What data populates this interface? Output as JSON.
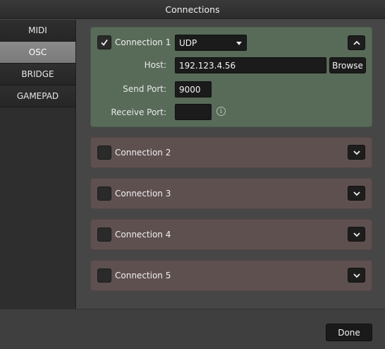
{
  "window": {
    "title": "Connections"
  },
  "sidebar": {
    "items": [
      {
        "label": "MIDI",
        "active": false
      },
      {
        "label": "OSC",
        "active": true
      },
      {
        "label": "BRIDGE",
        "active": false
      },
      {
        "label": "GAMEPAD",
        "active": false
      }
    ]
  },
  "connections": [
    {
      "label": "Connection 1",
      "checked": true,
      "expanded": true,
      "protocol": "UDP",
      "host_label": "Host:",
      "host": "192.123.4.56",
      "browse_label": "Browse",
      "send_port_label": "Send Port:",
      "send_port": "9000",
      "receive_port_label": "Receive Port:",
      "receive_port": "",
      "info_glyph": "i",
      "toggle_icon": "chevron-up-icon"
    },
    {
      "label": "Connection 2",
      "checked": false,
      "expanded": false,
      "toggle_icon": "chevron-down-icon"
    },
    {
      "label": "Connection 3",
      "checked": false,
      "expanded": false,
      "toggle_icon": "chevron-down-icon"
    },
    {
      "label": "Connection 4",
      "checked": false,
      "expanded": false,
      "toggle_icon": "chevron-down-icon"
    },
    {
      "label": "Connection 5",
      "checked": false,
      "expanded": false,
      "toggle_icon": "chevron-down-icon"
    }
  ],
  "footer": {
    "done_label": "Done"
  },
  "colors": {
    "active_panel": "#586a58",
    "inactive_panel": "#5f5050",
    "sidebar_active": "#8a8a8a"
  }
}
